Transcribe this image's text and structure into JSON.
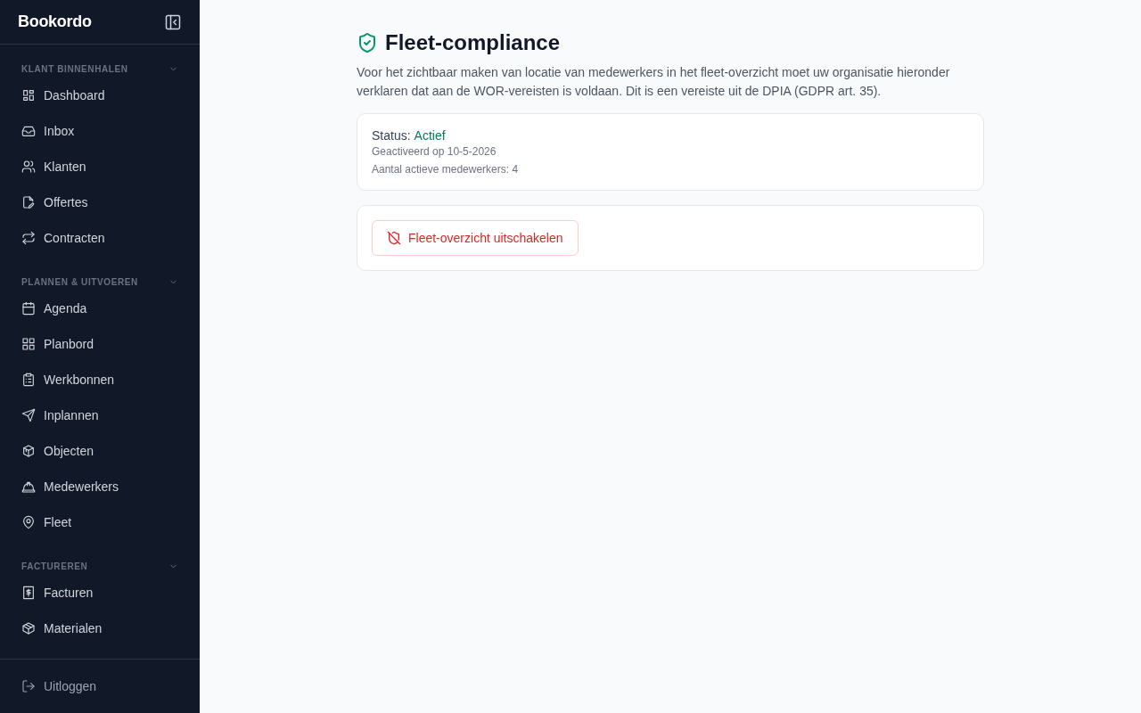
{
  "sidebar": {
    "brand": "Bookordo",
    "sections": [
      {
        "title": "KLANT BINNENHALEN",
        "expanded": true,
        "items": [
          {
            "label": "Dashboard",
            "selected": false
          },
          {
            "label": "Inbox",
            "selected": false
          },
          {
            "label": "Klanten",
            "selected": false
          },
          {
            "label": "Offertes",
            "selected": false
          },
          {
            "label": "Contracten",
            "selected": false
          }
        ]
      },
      {
        "title": "PLANNEN & UITVOEREN",
        "expanded": true,
        "items": [
          {
            "label": "Agenda",
            "selected": false
          },
          {
            "label": "Planbord",
            "selected": false
          },
          {
            "label": "Werkbonnen",
            "selected": false
          },
          {
            "label": "Inplannen",
            "selected": false
          },
          {
            "label": "Objecten",
            "selected": false
          },
          {
            "label": "Medewerkers",
            "selected": false
          },
          {
            "label": "Fleet",
            "selected": false
          }
        ]
      },
      {
        "title": "FACTUREREN",
        "expanded": true,
        "items": [
          {
            "label": "Facturen",
            "selected": false
          },
          {
            "label": "Materialen",
            "selected": false
          }
        ]
      }
    ],
    "logout": "Uitloggen"
  },
  "page": {
    "title": "Fleet-compliance",
    "description": "Voor het zichtbaar maken van locatie van medewerkers in het fleet-overzicht moet uw organisatie hieronder verklaren dat aan de WOR-vereisten is voldaan. Dit is een vereiste uit de DPIA (GDPR art. 35).",
    "status": {
      "label": "Status:",
      "value": "Actief",
      "active": true,
      "activated": "Geactiveerd op 10-5-2026",
      "employees": "Aantal actieve medewerkers: 4"
    },
    "disable_button": "Fleet-overzicht uitschakelen"
  }
}
